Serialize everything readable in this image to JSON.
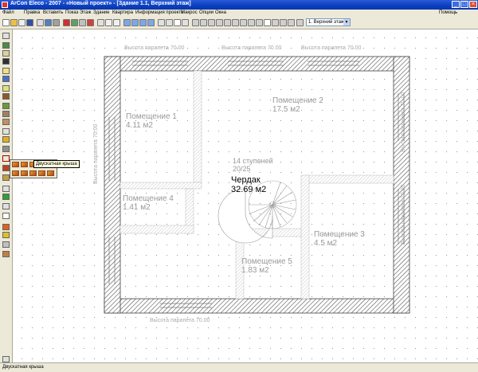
{
  "window": {
    "title": "ArCon Eleco - 2007 - «Новый проект» - [Здание 1.1, Верхний этаж]",
    "min_glyph": "_",
    "max_glyph": "□",
    "close_glyph": "×"
  },
  "menu": {
    "items": [
      "Файл",
      "Правка",
      "Вставить",
      "Показ",
      "Этаж",
      "Здание",
      "Квартира",
      "Информация проекта",
      "Макрос",
      "Опции",
      "Окна"
    ],
    "help": "Помощь"
  },
  "toolbar": {
    "floor_select": "1. Верхний этаж",
    "floor_arrow": "▼"
  },
  "plan": {
    "rooms": [
      {
        "name": "Помещение 1",
        "area": "4.11 м2"
      },
      {
        "name": "Помещение 2",
        "area": "17.5 м2"
      },
      {
        "name": "Помещение 3",
        "area": "4.5 м2"
      },
      {
        "name": "Помещение 4",
        "area": "1.41 м2"
      },
      {
        "name": "Помещение 5",
        "area": "1.83 м2"
      }
    ],
    "attic": {
      "name": "Чердак",
      "area": "32.69 м2"
    },
    "stairs": {
      "steps": "14 ступеней",
      "ratio": "20/25"
    },
    "parapet_label": "Высота парапета 70.00"
  },
  "roof_popup": {
    "tooltip": "Двускатная крыша"
  },
  "status": {
    "text": "Двускатная крыша"
  },
  "colors": {
    "titlebar": "#0a3fbf",
    "chrome": "#ece9d8",
    "room_text": "#999999",
    "attic_text": "#000000"
  }
}
